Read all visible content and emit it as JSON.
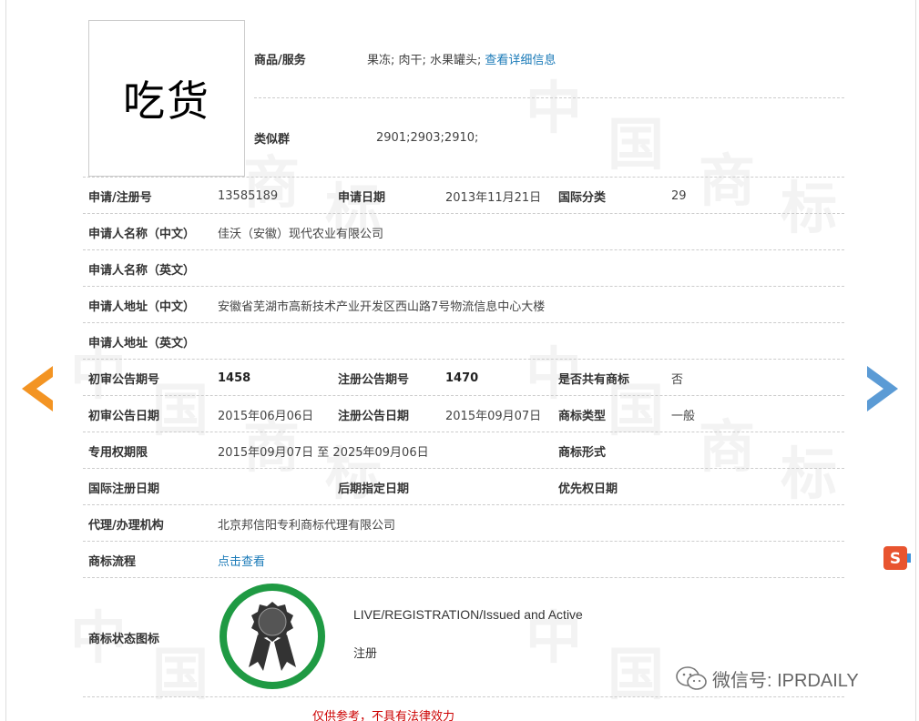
{
  "logo_text": "吃货",
  "top": {
    "goods_label": "商品/服务",
    "goods_value": "果冻; 肉干; 水果罐头;",
    "goods_link": "查看详细信息",
    "similar_label": "类似群",
    "similar_value": "2901;2903;2910;"
  },
  "rows": {
    "reg_no_label": "申请/注册号",
    "reg_no_value": "13585189",
    "apply_date_label": "申请日期",
    "apply_date_value": "2013年11月21日",
    "intl_class_label": "国际分类",
    "intl_class_value": "29",
    "applicant_cn_label": "申请人名称（中文）",
    "applicant_cn_value": "佳沃（安徽）现代农业有限公司",
    "applicant_en_label": "申请人名称（英文）",
    "address_cn_label": "申请人地址（中文）",
    "address_cn_value": "安徽省芜湖市高新技术产业开发区西山路7号物流信息中心大楼",
    "address_en_label": "申请人地址（英文）",
    "prelim_issue_label": "初审公告期号",
    "prelim_issue_value": "1458",
    "reg_issue_label": "注册公告期号",
    "reg_issue_value": "1470",
    "shared_label": "是否共有商标",
    "shared_value": "否",
    "prelim_date_label": "初审公告日期",
    "prelim_date_value": "2015年06月06日",
    "reg_date_label": "注册公告日期",
    "reg_date_value": "2015年09月07日",
    "tm_type_label": "商标类型",
    "tm_type_value": "一般",
    "exclusive_label": "专用权期限",
    "exclusive_value": "2015年09月07日 至 2025年09月06日",
    "tm_form_label": "商标形式",
    "intl_reg_date_label": "国际注册日期",
    "later_date_label": "后期指定日期",
    "priority_date_label": "优先权日期",
    "agent_label": "代理/办理机构",
    "agent_value": "北京邦信阳专利商标代理有限公司",
    "process_label": "商标流程",
    "process_link": "点击查看"
  },
  "status": {
    "label": "商标状态图标",
    "en": "LIVE/REGISTRATION/Issued and Active",
    "cn": "注册"
  },
  "disclaimer": "仅供参考，不具有法律效力",
  "watermark": "中国商标",
  "wechat_text": "微信号: IPRDAILY",
  "colors": {
    "link": "#1a7ab8",
    "disclaimer": "#cc0000",
    "arrow_left": "#f39423",
    "arrow_right": "#5b9bd5",
    "badge_ring": "#1f9a43"
  },
  "icons": [
    "arrow-left-icon",
    "arrow-right-icon",
    "award-badge-icon",
    "sogou-icon",
    "wechat-icon"
  ]
}
